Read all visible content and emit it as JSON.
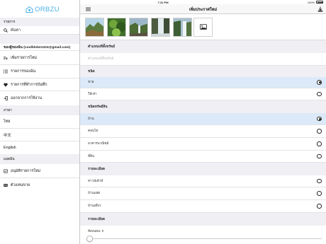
{
  "status_bar": {
    "left": "iPad",
    "time": "7:31 PM",
    "battery": "100%"
  },
  "sidebar": {
    "logo_text": "ORBZU",
    "section_items": "รายการ",
    "search": "ค้นหา",
    "account_header": "ของผู้ของฉัน (coolbloke1324@gmail.com)",
    "add_listing": "เพิ่มรายการใหม่",
    "my_listings": "รายการของฉัน",
    "saved_listings": "รายการที่ทำการบันทึก",
    "logout": "ออกจากการใช้งาน",
    "section_language": "ภาษา",
    "lang_thai": "ไทย",
    "lang_chinese": "中文",
    "lang_english": "English",
    "section_admin": "แอดมิน",
    "approve_listings": "อนุมัติรายการใหม่",
    "agent_card": "ตัวแทนขาย"
  },
  "navbar": {
    "title": "เพิ่มประกาศใหม่"
  },
  "main": {
    "location_header": "ตำแหน่งที่ตั้งทรัพย์",
    "location_placeholder": "ตำแหน่งที่ตั้งทรัพย์",
    "type_header": "ชนิด",
    "type_sell": "ขาย",
    "type_rent": "ให้เช่า",
    "property_type_header": "ชนิดทรัพย์สิน",
    "prop_house": "บ้าน",
    "prop_condo": "คอนโด",
    "prop_building": "อาคารพาณิชย์",
    "prop_land": "ที่ดิน",
    "detail_header_1": "รายละเอียด",
    "detail_townhouse": "ทาวน์เฮ้าส์",
    "detail_twin": "บ้านแฝด",
    "detail_single": "บ้านเดี่ยว",
    "detail_header_2": "รายละเอียด",
    "bedrooms_label": "ห้องนอน: 0"
  },
  "form_values": {
    "bedrooms": 0
  },
  "colors": {
    "accent": "#4ab0e6",
    "selected_row": "#dbe9f8",
    "section_bg": "#efeff4"
  }
}
